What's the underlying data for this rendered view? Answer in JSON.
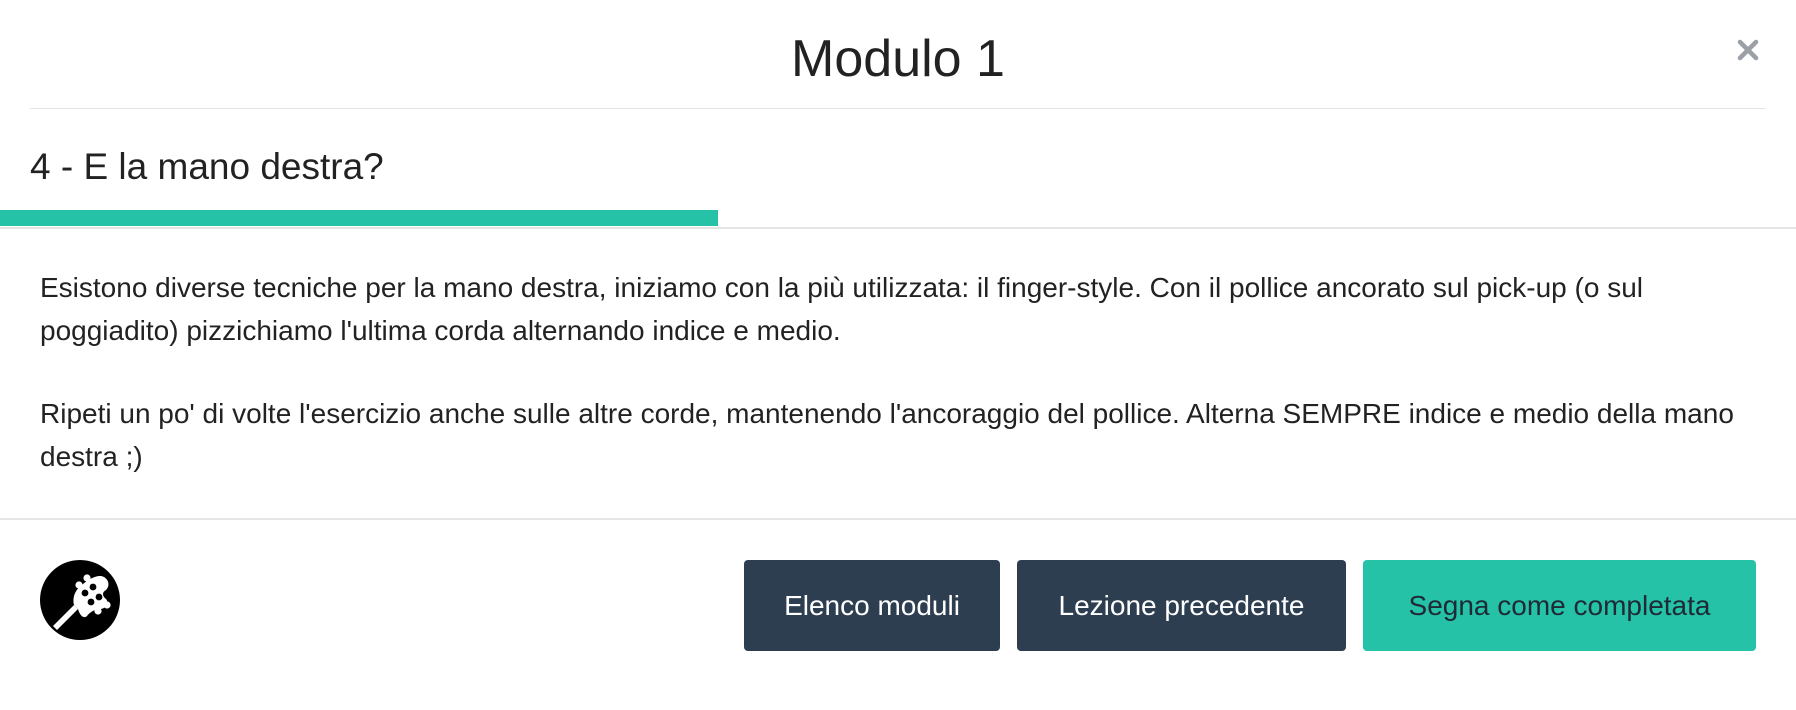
{
  "modal": {
    "title": "Modulo 1",
    "close_icon": "close-icon"
  },
  "lesson": {
    "title": "4 - E la mano destra?",
    "progress_fraction": 0.4,
    "paragraphs": [
      "Esistono diverse tecniche per la mano destra, iniziamo con la più utilizzata: il finger-style. Con il pollice ancorato sul pick-up (o sul poggiadito) pizzichiamo l'ultima corda alternando indice e medio.",
      "Ripeti un po' di volte l'esercizio anche sulle altre corde, mantenendo l'ancoraggio del pollice. Alterna SEMPRE indice e medio della mano destra ;)"
    ]
  },
  "footer": {
    "logo_icon": "bass-headstock-icon",
    "module_list_label": "Elenco moduli",
    "previous_lesson_label": "Lezione precedente",
    "mark_complete_label": "Segna come completata"
  },
  "colors": {
    "accent": "#26c2a8",
    "dark_button": "#2e3e51",
    "close_icon": "#9aa0a6"
  }
}
